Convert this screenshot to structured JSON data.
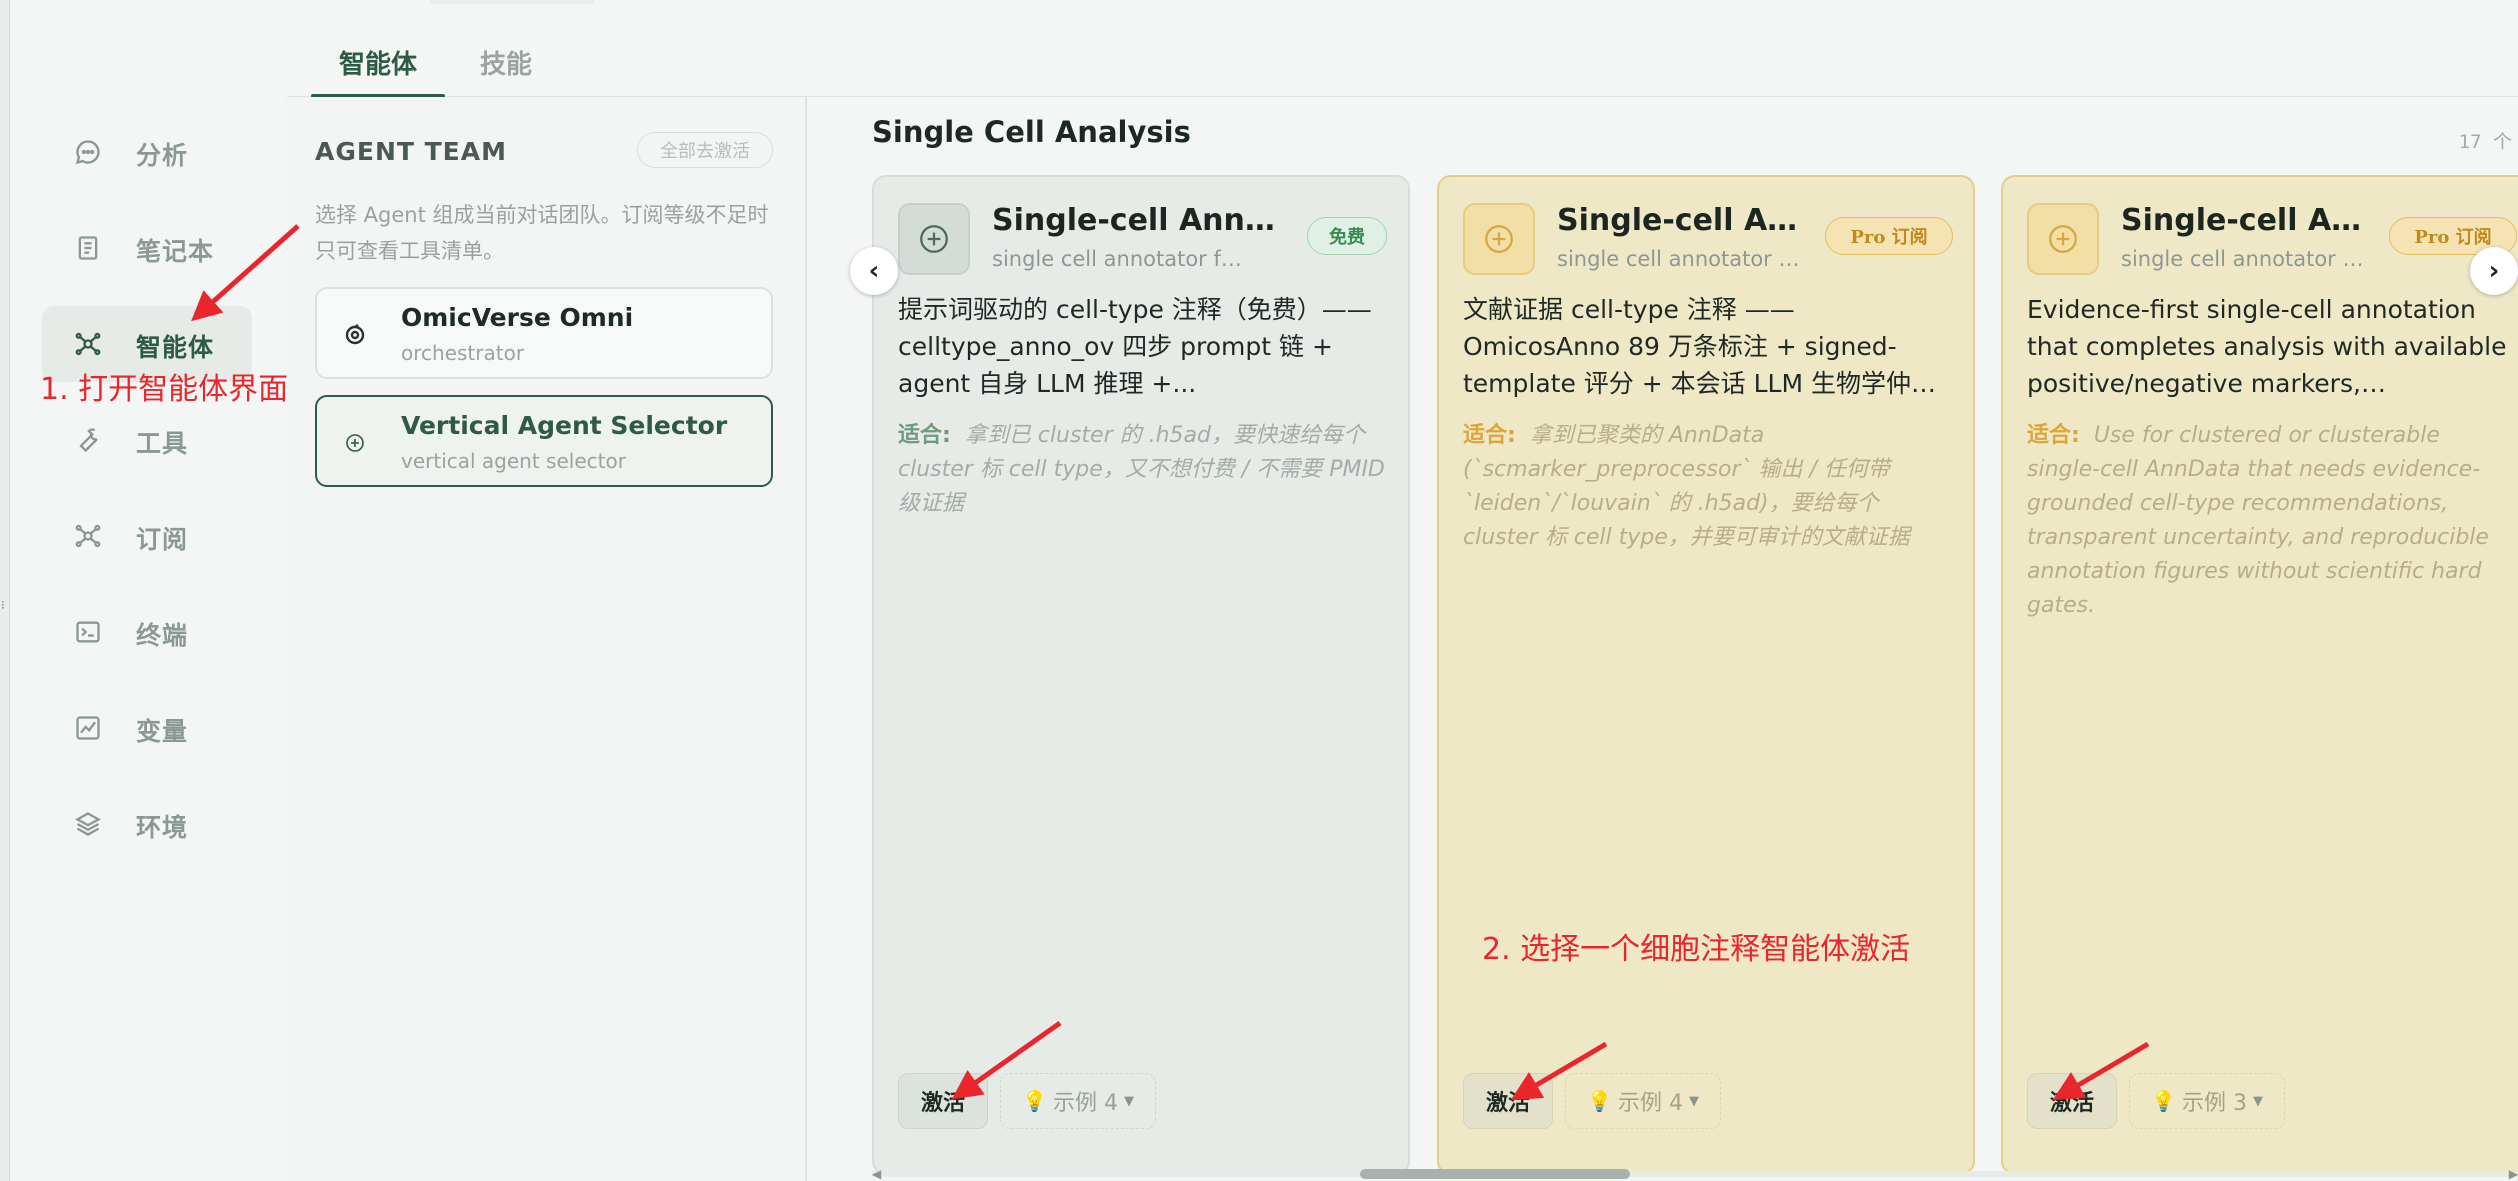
{
  "sidebar": {
    "items": [
      {
        "label": "分析",
        "icon": "chat-icon"
      },
      {
        "label": "笔记本",
        "icon": "notebook-icon"
      },
      {
        "label": "智能体",
        "icon": "agent-network-icon",
        "active": true
      },
      {
        "label": "工具",
        "icon": "wrench-icon"
      },
      {
        "label": "订阅",
        "icon": "network-icon"
      },
      {
        "label": "终端",
        "icon": "terminal-icon"
      },
      {
        "label": "变量",
        "icon": "chart-box-icon"
      },
      {
        "label": "环境",
        "icon": "layers-icon"
      }
    ]
  },
  "tabs": [
    {
      "label": "智能体",
      "active": true
    },
    {
      "label": "技能",
      "active": false
    }
  ],
  "team": {
    "title": "AGENT TEAM",
    "deactivate_all": "全部去激活",
    "description": "选择 Agent 组成当前对话团队。订阅等级不足时只可查看工具清单。",
    "agents": [
      {
        "name": "OmicVerse Omni",
        "sub": "orchestrator",
        "icon": "target-icon"
      },
      {
        "name": "Vertical Agent Selector",
        "sub": "vertical agent selector",
        "icon": "plus-circle-icon",
        "selected": true
      }
    ]
  },
  "main": {
    "section_title": "Single Cell Analysis",
    "count": "17 个",
    "cards": [
      {
        "tier": "free",
        "name": "Single-cell Annotator",
        "sub": "single cell annotator free",
        "badge": "免费",
        "description": "提示词驱动的 cell-type 注释（免费）——celltype_anno_ov 四步 prompt 链 + agent 自身 LLM 推理 +...",
        "fit_label": "适合:",
        "fit_text": "拿到已 cluster 的 .h5ad，要快速给每个 cluster 标 cell type，又不想付费 / 不需要 PMID 级证据",
        "activate": "激活",
        "examples": "示例 4"
      },
      {
        "tier": "pro",
        "name": "Single-cell Annotator Pro",
        "sub": "single cell annotator pro",
        "badge": "Pro 订阅",
        "description": "文献证据 cell-type 注释 —— OmicosAnno 89 万条标注 + signed-template 评分 + 本会话 LLM 生物学仲裁 + PubMed 句子级证据",
        "fit_label": "适合:",
        "fit_text": "拿到已聚类的 AnnData (`scmarker_preprocessor` 输出 / 任何带 `leiden`/`louvain` 的 .h5ad)，要给每个 cluster 标 cell type，并要可审计的文献证据",
        "activate": "激活",
        "examples": "示例 4"
      },
      {
        "tier": "pro",
        "name": "Single-cell Annotator Pro",
        "sub": "single cell annotator pro",
        "badge": "Pro 订阅",
        "description": "Evidence-first single-cell annotation that completes analysis with available positive/negative markers, OmicosAnno...",
        "fit_label": "适合:",
        "fit_text": "Use for clustered or clusterable single-cell AnnData that needs evidence-grounded cell-type recommendations, transparent uncertainty, and reproducible annotation figures without scientific hard gates.",
        "activate": "激活",
        "examples": "示例 3"
      }
    ]
  },
  "annotations": {
    "step1": "1. 打开智能体界面",
    "step2": "2. 选择一个细胞注释智能体激活"
  },
  "colors": {
    "accent": "#2e5a46",
    "pro": "#dca53a",
    "free_badge": "#3a8a55",
    "annotation": "#e8262c"
  }
}
